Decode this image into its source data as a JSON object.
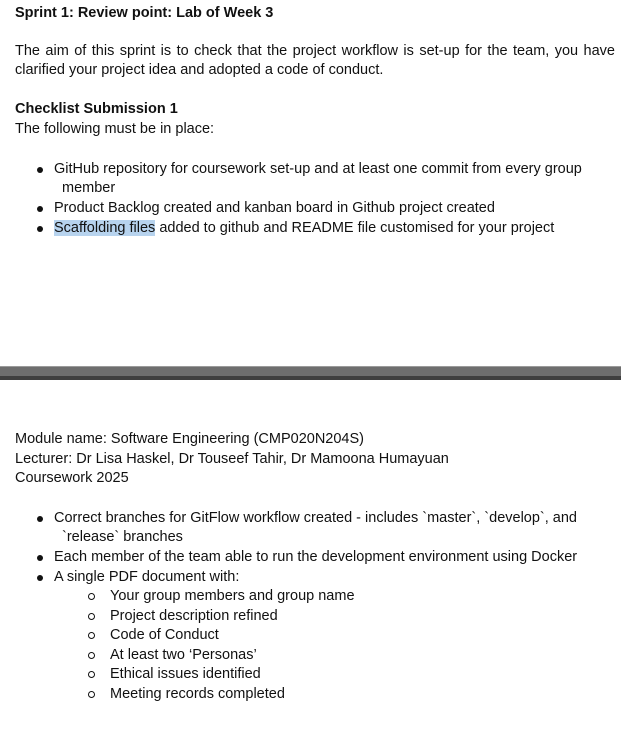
{
  "page1": {
    "title": "Sprint 1: Review point: Lab of Week 3",
    "aim": "The aim of this sprint is to check that the project workflow is set-up for the team, you have clarified your project idea and adopted a code of conduct.",
    "checklist_heading": "Checklist Submission 1",
    "checklist_intro": "The following must be in place:",
    "items": [
      {
        "text": "GitHub repository for coursework set-up and at least one commit from every group",
        "cont": "member"
      },
      {
        "text": "Product Backlog created and kanban board in Github project created"
      },
      {
        "highlight": "Scaffolding files",
        "rest": " added to github and README file customised for your project"
      }
    ]
  },
  "page2": {
    "module": "Module name: Software Engineering (CMP020N204S)",
    "lecturers": "Lecturer: Dr Lisa Haskel, Dr Touseef Tahir, Dr Mamoona Humayuan",
    "coursework": "Coursework 2025",
    "items": [
      {
        "text": "Correct branches for GitFlow workflow created - includes `master`, `develop`, and",
        "cont": "`release` branches"
      },
      {
        "text": "Each member of the team able to run the development environment using Docker"
      },
      {
        "text": "A single PDF document with:"
      }
    ],
    "sub_items": [
      "Your group members and group name",
      "Project description refined",
      "Code of Conduct",
      "At least two ‘Personas’",
      "Ethical issues identified",
      "Meeting records completed"
    ]
  }
}
